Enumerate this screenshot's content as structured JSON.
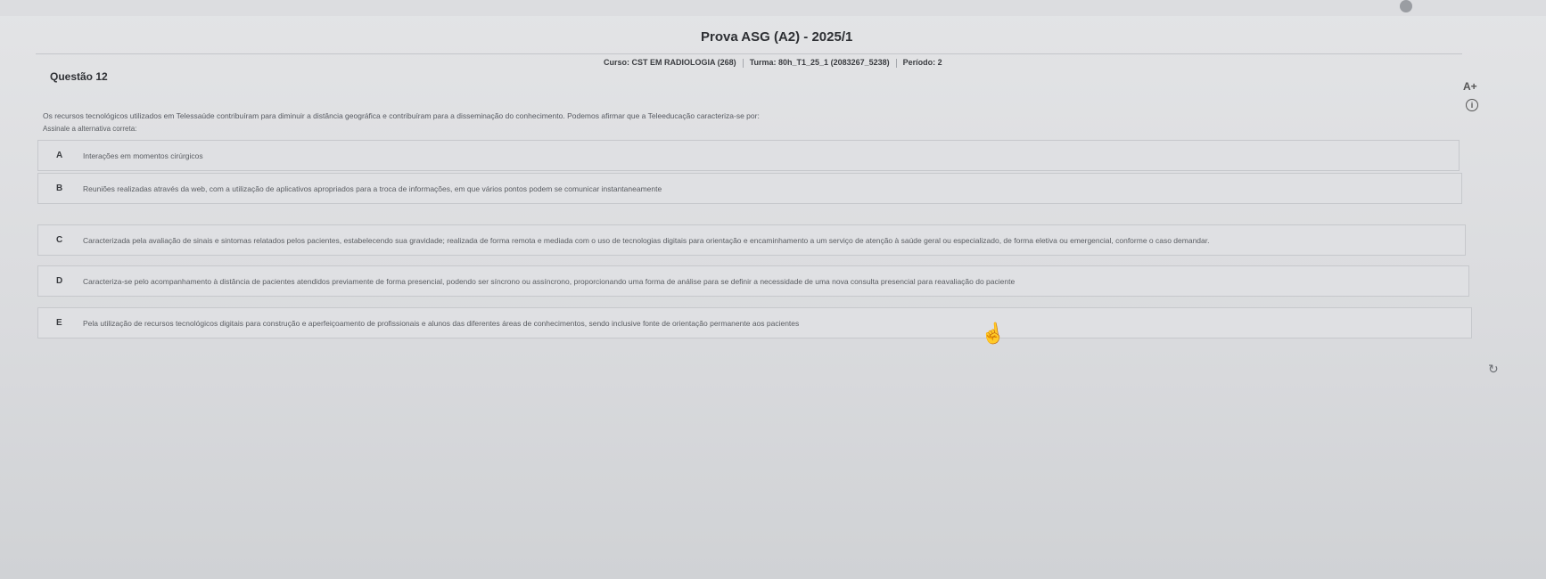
{
  "header": {
    "exam_title": "Prova ASG (A2) - 2025/1",
    "course_label": "Curso: CST EM RADIOLOGIA (268)",
    "class_label": "Turma: 80h_T1_25_1 (2083267_5238)",
    "period_label": "Período: 2"
  },
  "question": {
    "title": "Questão 12",
    "statement": "Os recursos tecnológicos utilizados em Telessaúde contribuíram para diminuir a distância geográfica e contribuíram para a disseminação do conhecimento. Podemos afirmar que a Teleeducação caracteriza-se por:",
    "instruction": "Assinale a alternativa correta:",
    "options": [
      {
        "letter": "A",
        "text": "Interações em momentos cirúrgicos"
      },
      {
        "letter": "B",
        "text": "Reuniões realizadas através da web, com a utilização de aplicativos apropriados para a troca de informações, em que vários pontos podem se comunicar instantaneamente"
      },
      {
        "letter": "C",
        "text": "Caracterizada pela avaliação de sinais e sintomas relatados pelos pacientes, estabelecendo sua gravidade; realizada de forma remota e mediada com o uso de tecnologias digitais para orientação e encaminhamento a um serviço de atenção à saúde geral ou especializado, de forma eletiva ou emergencial, conforme o caso demandar."
      },
      {
        "letter": "D",
        "text": "Caracteriza-se pelo acompanhamento à distância de pacientes atendidos previamente de forma presencial, podendo ser síncrono ou assíncrono, proporcionando uma forma de análise para se definir a necessidade de uma nova consulta presencial para reavaliação do paciente"
      },
      {
        "letter": "E",
        "text": "Pela utilização de recursos tecnológicos digitais para construção e aperfeiçoamento de profissionais e alunos das diferentes áreas de conhecimentos, sendo inclusive fonte de orientação permanente aos pacientes"
      }
    ]
  },
  "tools": {
    "font_size_icon": "A+",
    "info_icon": "i",
    "refresh_icon": "↻",
    "cursor_icon": "☝"
  }
}
